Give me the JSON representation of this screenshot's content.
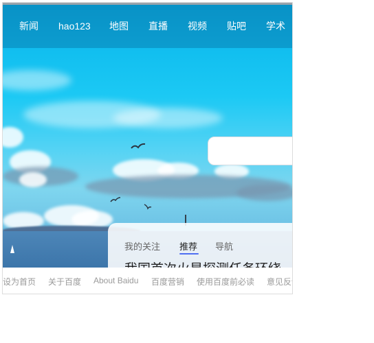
{
  "nav": {
    "items": [
      {
        "label": "新闻"
      },
      {
        "label": "hao123"
      },
      {
        "label": "地图"
      },
      {
        "label": "直播"
      },
      {
        "label": "视频"
      },
      {
        "label": "贴吧"
      },
      {
        "label": "学术"
      }
    ]
  },
  "search": {
    "placeholder": "",
    "value": ""
  },
  "feed": {
    "tabs": [
      {
        "label": "我的关注"
      },
      {
        "label": "推荐"
      },
      {
        "label": "导航"
      }
    ],
    "active_tab": "推荐",
    "headline": "我国首次火星探测任务环绕"
  },
  "footer": {
    "links": [
      {
        "label": "设为首页"
      },
      {
        "label": "关于百度"
      },
      {
        "label": "About Baidu"
      },
      {
        "label": "百度营销"
      },
      {
        "label": "使用百度前必读"
      },
      {
        "label": "意见反馈"
      }
    ]
  },
  "colors": {
    "tab_underline": "#4e6ef2",
    "nav_text": "#ffffff",
    "footer_text": "#9a9a9a"
  }
}
